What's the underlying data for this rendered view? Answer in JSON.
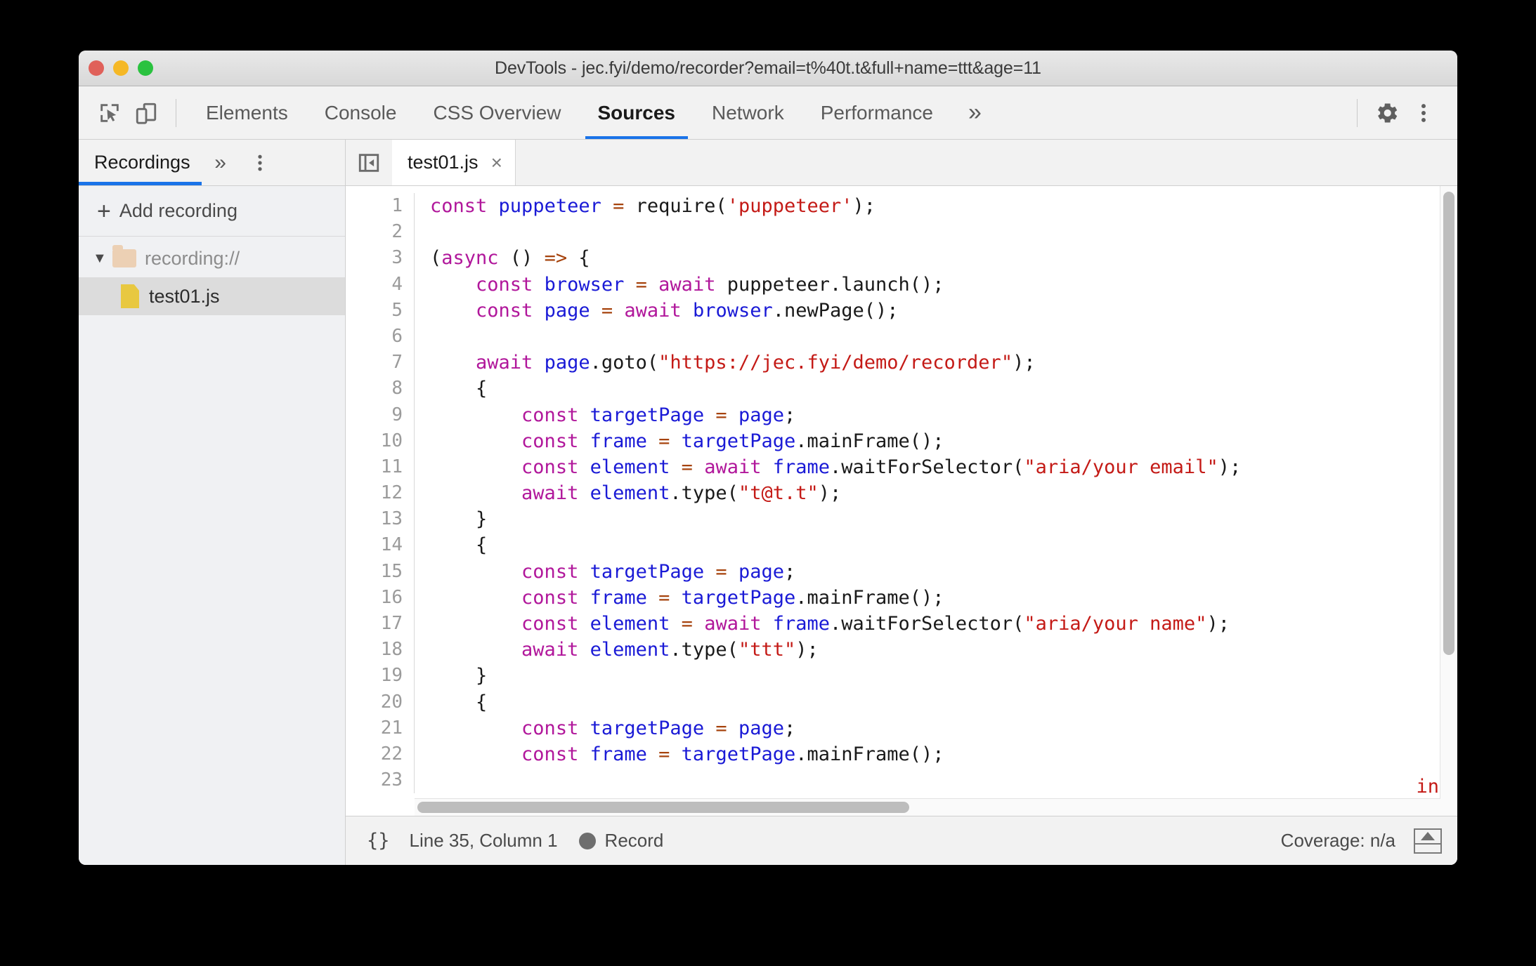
{
  "window": {
    "title": "DevTools - jec.fyi/demo/recorder?email=t%40t.t&full+name=ttt&age=11",
    "traffic_lights": [
      "close",
      "minimize",
      "maximize"
    ],
    "colors": {
      "close": "#e0615a",
      "minimize": "#f5b826",
      "maximize": "#2ac23f",
      "accent": "#1a73e8",
      "string": "#c41a16",
      "keyword": "#b1179b",
      "identifier": "#1a1ad6",
      "operator": "#a6430d"
    }
  },
  "toolbar": {
    "icons": [
      "inspect-element-icon",
      "device-toolbar-icon"
    ],
    "tabs": [
      {
        "label": "Elements",
        "active": false
      },
      {
        "label": "Console",
        "active": false
      },
      {
        "label": "CSS Overview",
        "active": false
      },
      {
        "label": "Sources",
        "active": true
      },
      {
        "label": "Network",
        "active": false
      },
      {
        "label": "Performance",
        "active": false
      }
    ],
    "more_tabs": "»",
    "settings_icon": "gear-icon",
    "menu_icon": "kebab-menu-icon"
  },
  "sidebar": {
    "tab_label": "Recordings",
    "more": "»",
    "kebab": "kebab-menu-icon",
    "add_recording": "Add recording",
    "add_icon": "plus-icon",
    "tree": [
      {
        "label": "recording://",
        "type": "folder",
        "expanded": true,
        "caret": "▼"
      },
      {
        "label": "test01.js",
        "type": "file",
        "selected": true
      }
    ]
  },
  "editor": {
    "nav_toggle_icon": "collapse-navigator-icon",
    "tab_label": "test01.js",
    "close_label": "×",
    "first_line": 1,
    "lines": [
      {
        "n": 1,
        "tokens": [
          {
            "t": "const",
            "c": "kw"
          },
          {
            "t": " ",
            "c": "pl"
          },
          {
            "t": "puppeteer",
            "c": "id"
          },
          {
            "t": " ",
            "c": "pl"
          },
          {
            "t": "=",
            "c": "op"
          },
          {
            "t": " require(",
            "c": "pl"
          },
          {
            "t": "'puppeteer'",
            "c": "str"
          },
          {
            "t": ");",
            "c": "pl"
          }
        ]
      },
      {
        "n": 2,
        "tokens": []
      },
      {
        "n": 3,
        "tokens": [
          {
            "t": "(",
            "c": "pl"
          },
          {
            "t": "async",
            "c": "kw"
          },
          {
            "t": " () ",
            "c": "pl"
          },
          {
            "t": "=>",
            "c": "op"
          },
          {
            "t": " {",
            "c": "pl"
          }
        ]
      },
      {
        "n": 4,
        "tokens": [
          {
            "t": "    ",
            "c": "pl"
          },
          {
            "t": "const",
            "c": "kw"
          },
          {
            "t": " ",
            "c": "pl"
          },
          {
            "t": "browser",
            "c": "id"
          },
          {
            "t": " ",
            "c": "pl"
          },
          {
            "t": "=",
            "c": "op"
          },
          {
            "t": " ",
            "c": "pl"
          },
          {
            "t": "await",
            "c": "kw"
          },
          {
            "t": " puppeteer.launch();",
            "c": "pl"
          }
        ]
      },
      {
        "n": 5,
        "tokens": [
          {
            "t": "    ",
            "c": "pl"
          },
          {
            "t": "const",
            "c": "kw"
          },
          {
            "t": " ",
            "c": "pl"
          },
          {
            "t": "page",
            "c": "id"
          },
          {
            "t": " ",
            "c": "pl"
          },
          {
            "t": "=",
            "c": "op"
          },
          {
            "t": " ",
            "c": "pl"
          },
          {
            "t": "await",
            "c": "kw"
          },
          {
            "t": " ",
            "c": "pl"
          },
          {
            "t": "browser",
            "c": "id"
          },
          {
            "t": ".newPage();",
            "c": "pl"
          }
        ]
      },
      {
        "n": 6,
        "tokens": []
      },
      {
        "n": 7,
        "tokens": [
          {
            "t": "    ",
            "c": "pl"
          },
          {
            "t": "await",
            "c": "kw"
          },
          {
            "t": " ",
            "c": "pl"
          },
          {
            "t": "page",
            "c": "id"
          },
          {
            "t": ".goto(",
            "c": "pl"
          },
          {
            "t": "\"https://jec.fyi/demo/recorder\"",
            "c": "str"
          },
          {
            "t": ");",
            "c": "pl"
          }
        ]
      },
      {
        "n": 8,
        "tokens": [
          {
            "t": "    {",
            "c": "pl"
          }
        ]
      },
      {
        "n": 9,
        "tokens": [
          {
            "t": "        ",
            "c": "pl"
          },
          {
            "t": "const",
            "c": "kw"
          },
          {
            "t": " ",
            "c": "pl"
          },
          {
            "t": "targetPage",
            "c": "id"
          },
          {
            "t": " ",
            "c": "pl"
          },
          {
            "t": "=",
            "c": "op"
          },
          {
            "t": " ",
            "c": "pl"
          },
          {
            "t": "page",
            "c": "id"
          },
          {
            "t": ";",
            "c": "pl"
          }
        ]
      },
      {
        "n": 10,
        "tokens": [
          {
            "t": "        ",
            "c": "pl"
          },
          {
            "t": "const",
            "c": "kw"
          },
          {
            "t": " ",
            "c": "pl"
          },
          {
            "t": "frame",
            "c": "id"
          },
          {
            "t": " ",
            "c": "pl"
          },
          {
            "t": "=",
            "c": "op"
          },
          {
            "t": " ",
            "c": "pl"
          },
          {
            "t": "targetPage",
            "c": "id"
          },
          {
            "t": ".mainFrame();",
            "c": "pl"
          }
        ]
      },
      {
        "n": 11,
        "tokens": [
          {
            "t": "        ",
            "c": "pl"
          },
          {
            "t": "const",
            "c": "kw"
          },
          {
            "t": " ",
            "c": "pl"
          },
          {
            "t": "element",
            "c": "id"
          },
          {
            "t": " ",
            "c": "pl"
          },
          {
            "t": "=",
            "c": "op"
          },
          {
            "t": " ",
            "c": "pl"
          },
          {
            "t": "await",
            "c": "kw"
          },
          {
            "t": " ",
            "c": "pl"
          },
          {
            "t": "frame",
            "c": "id"
          },
          {
            "t": ".waitForSelector(",
            "c": "pl"
          },
          {
            "t": "\"aria/your email\"",
            "c": "str"
          },
          {
            "t": ");",
            "c": "pl"
          }
        ]
      },
      {
        "n": 12,
        "tokens": [
          {
            "t": "        ",
            "c": "pl"
          },
          {
            "t": "await",
            "c": "kw"
          },
          {
            "t": " ",
            "c": "pl"
          },
          {
            "t": "element",
            "c": "id"
          },
          {
            "t": ".type(",
            "c": "pl"
          },
          {
            "t": "\"t@t.t\"",
            "c": "str"
          },
          {
            "t": ");",
            "c": "pl"
          }
        ]
      },
      {
        "n": 13,
        "tokens": [
          {
            "t": "    }",
            "c": "pl"
          }
        ]
      },
      {
        "n": 14,
        "tokens": [
          {
            "t": "    {",
            "c": "pl"
          }
        ]
      },
      {
        "n": 15,
        "tokens": [
          {
            "t": "        ",
            "c": "pl"
          },
          {
            "t": "const",
            "c": "kw"
          },
          {
            "t": " ",
            "c": "pl"
          },
          {
            "t": "targetPage",
            "c": "id"
          },
          {
            "t": " ",
            "c": "pl"
          },
          {
            "t": "=",
            "c": "op"
          },
          {
            "t": " ",
            "c": "pl"
          },
          {
            "t": "page",
            "c": "id"
          },
          {
            "t": ";",
            "c": "pl"
          }
        ]
      },
      {
        "n": 16,
        "tokens": [
          {
            "t": "        ",
            "c": "pl"
          },
          {
            "t": "const",
            "c": "kw"
          },
          {
            "t": " ",
            "c": "pl"
          },
          {
            "t": "frame",
            "c": "id"
          },
          {
            "t": " ",
            "c": "pl"
          },
          {
            "t": "=",
            "c": "op"
          },
          {
            "t": " ",
            "c": "pl"
          },
          {
            "t": "targetPage",
            "c": "id"
          },
          {
            "t": ".mainFrame();",
            "c": "pl"
          }
        ]
      },
      {
        "n": 17,
        "tokens": [
          {
            "t": "        ",
            "c": "pl"
          },
          {
            "t": "const",
            "c": "kw"
          },
          {
            "t": " ",
            "c": "pl"
          },
          {
            "t": "element",
            "c": "id"
          },
          {
            "t": " ",
            "c": "pl"
          },
          {
            "t": "=",
            "c": "op"
          },
          {
            "t": " ",
            "c": "pl"
          },
          {
            "t": "await",
            "c": "kw"
          },
          {
            "t": " ",
            "c": "pl"
          },
          {
            "t": "frame",
            "c": "id"
          },
          {
            "t": ".waitForSelector(",
            "c": "pl"
          },
          {
            "t": "\"aria/your name\"",
            "c": "str"
          },
          {
            "t": ");",
            "c": "pl"
          }
        ]
      },
      {
        "n": 18,
        "tokens": [
          {
            "t": "        ",
            "c": "pl"
          },
          {
            "t": "await",
            "c": "kw"
          },
          {
            "t": " ",
            "c": "pl"
          },
          {
            "t": "element",
            "c": "id"
          },
          {
            "t": ".type(",
            "c": "pl"
          },
          {
            "t": "\"ttt\"",
            "c": "str"
          },
          {
            "t": ");",
            "c": "pl"
          }
        ]
      },
      {
        "n": 19,
        "tokens": [
          {
            "t": "    }",
            "c": "pl"
          }
        ]
      },
      {
        "n": 20,
        "tokens": [
          {
            "t": "    {",
            "c": "pl"
          }
        ]
      },
      {
        "n": 21,
        "tokens": [
          {
            "t": "        ",
            "c": "pl"
          },
          {
            "t": "const",
            "c": "kw"
          },
          {
            "t": " ",
            "c": "pl"
          },
          {
            "t": "targetPage",
            "c": "id"
          },
          {
            "t": " ",
            "c": "pl"
          },
          {
            "t": "=",
            "c": "op"
          },
          {
            "t": " ",
            "c": "pl"
          },
          {
            "t": "page",
            "c": "id"
          },
          {
            "t": ";",
            "c": "pl"
          }
        ]
      },
      {
        "n": 22,
        "tokens": [
          {
            "t": "        ",
            "c": "pl"
          },
          {
            "t": "const",
            "c": "kw"
          },
          {
            "t": " ",
            "c": "pl"
          },
          {
            "t": "frame",
            "c": "id"
          },
          {
            "t": " ",
            "c": "pl"
          },
          {
            "t": "=",
            "c": "op"
          },
          {
            "t": " ",
            "c": "pl"
          },
          {
            "t": "targetPage",
            "c": "id"
          },
          {
            "t": ".mainFrame();",
            "c": "pl"
          }
        ]
      },
      {
        "n": 23,
        "tokens": []
      }
    ],
    "clipped_string_fragment": "in"
  },
  "statusbar": {
    "pretty_print": "{}",
    "position": "Line 35, Column 1",
    "record_label": "Record",
    "record_icon": "record-dot-icon",
    "coverage": "Coverage: n/a",
    "drawer_icon": "show-drawer-icon"
  }
}
